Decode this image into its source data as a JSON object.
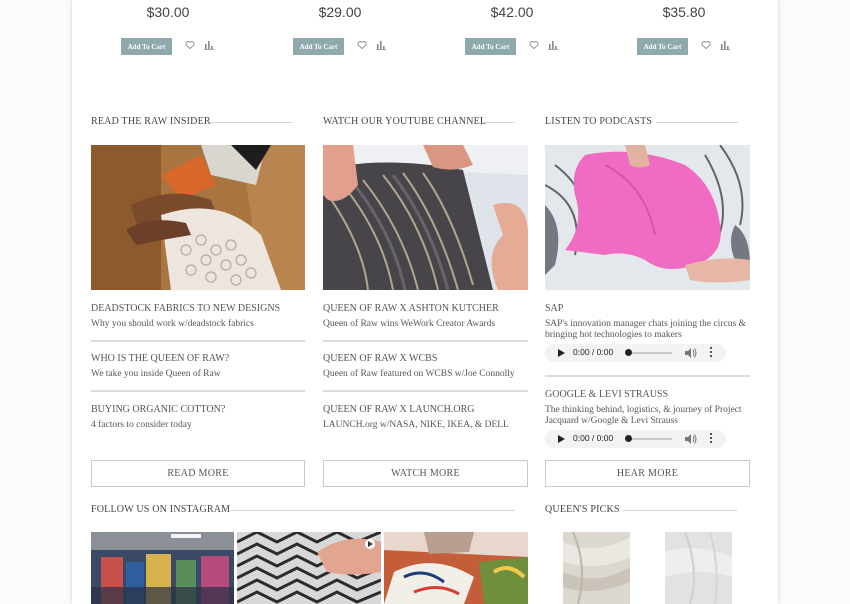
{
  "products": [
    {
      "price": "$30.00",
      "cart_label": "Add To Cart"
    },
    {
      "price": "$29.00",
      "cart_label": "Add To Cart"
    },
    {
      "price": "$42.00",
      "cart_label": "Add To Cart"
    },
    {
      "price": "$35.80",
      "cart_label": "Add To Cart"
    }
  ],
  "insider": {
    "title": "READ THE RAW INSIDER",
    "entries": [
      {
        "title": "DEADSTOCK FABRICS TO NEW DESIGNS",
        "sub": "Why you should work w/deadstock fabrics"
      },
      {
        "title": "WHO IS THE QUEEN OF RAW?",
        "sub": "We take you inside Queen of Raw"
      },
      {
        "title": "BUYING ORGANIC COTTON?",
        "sub": "4 factors to consider today"
      }
    ],
    "button": "READ MORE"
  },
  "youtube": {
    "title": "WATCH OUR YOUTUBE CHANNEL",
    "entries": [
      {
        "title": "QUEEN OF RAW X ASHTON KUTCHER",
        "sub": "Queen of Raw wins WeWork Creator Awards"
      },
      {
        "title": "QUEEN OF RAW X WCBS",
        "sub": "Queen of Raw featured on WCBS w/Joe Connolly"
      },
      {
        "title": "QUEEN OF RAW X LAUNCH.ORG",
        "sub": "LAUNCH.org w/NASA, NIKE, IKEA, & DELL"
      }
    ],
    "button": "WATCH MORE"
  },
  "podcasts": {
    "title": "LISTEN TO PODCASTS",
    "entries": [
      {
        "title": "SAP",
        "sub": "SAP's innovation manager chats joining the circus & bringing hot technologies to makers",
        "time": "0:00 / 0:00"
      },
      {
        "title": "GOOGLE & LEVI STRAUSS",
        "sub": "The thinking behind, logistics, & journey of Project Jacquard w/Google & Levi Strauss",
        "time": "0:00 / 0:00"
      }
    ],
    "button": "HEAR MORE"
  },
  "instagram": {
    "title": "FOLLOW US ON INSTAGRAM"
  },
  "picks": {
    "title": "QUEEN'S PICKS"
  },
  "colors": {
    "accent": "#8fa9ad",
    "pink": "#f06bc2",
    "divider": "#dcdcdc"
  },
  "icons": [
    "heart-icon",
    "bar-chart-icon",
    "play-icon",
    "volume-icon",
    "more-vertical-icon"
  ]
}
